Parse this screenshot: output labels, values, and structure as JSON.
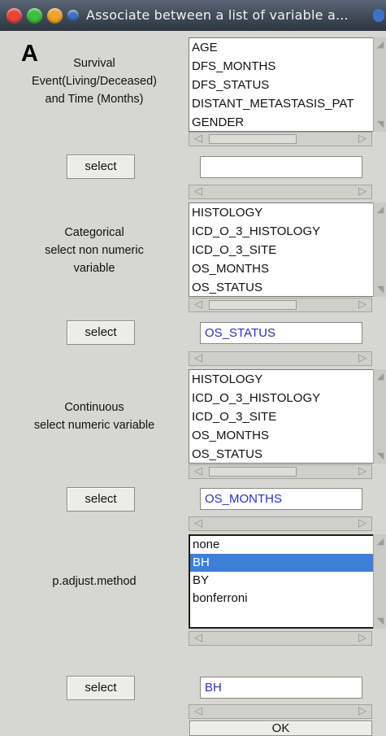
{
  "window": {
    "title": "Associate between a list of variable a...",
    "panel_letter": "A",
    "colors": {
      "close": "#e8443a",
      "minimize": "#3fbd3c",
      "maximize": "#f0a22c",
      "selection": "#3d7fd8",
      "entry_text": "#2a33b8"
    }
  },
  "sections": [
    {
      "label_lines": [
        "Survival",
        "Event(Living/Deceased)",
        "and Time (Months)"
      ],
      "list_items": [
        "AGE",
        "DFS_MONTHS",
        "DFS_STATUS",
        "DISTANT_METASTASIS_PAT",
        "GENDER"
      ],
      "selected_index": null,
      "button": "select",
      "entry_value": ""
    },
    {
      "label_lines": [
        "Categorical",
        "select non numeric",
        "variable"
      ],
      "list_items": [
        "HISTOLOGY",
        "ICD_O_3_HISTOLOGY",
        "ICD_O_3_SITE",
        "OS_MONTHS",
        "OS_STATUS"
      ],
      "selected_index": null,
      "button": "select",
      "entry_value": "OS_STATUS"
    },
    {
      "label_lines": [
        "Continuous",
        "select numeric variable"
      ],
      "list_items": [
        "HISTOLOGY",
        "ICD_O_3_HISTOLOGY",
        "ICD_O_3_SITE",
        "OS_MONTHS",
        "OS_STATUS"
      ],
      "selected_index": null,
      "button": "select",
      "entry_value": "OS_MONTHS"
    },
    {
      "label_lines": [
        "p.adjust.method"
      ],
      "list_items": [
        "none",
        "BH",
        "BY",
        "bonferroni"
      ],
      "selected_index": 1,
      "button": "select",
      "entry_value": "BH"
    }
  ],
  "ok_button": "OK",
  "icons": {
    "close": "close-icon",
    "minimize": "minimize-icon",
    "maximize": "maximize-icon",
    "scroll_left": "arrow-left-icon",
    "scroll_right": "arrow-right-icon",
    "scroll_up": "arrow-up-icon",
    "scroll_down": "arrow-down-icon"
  }
}
